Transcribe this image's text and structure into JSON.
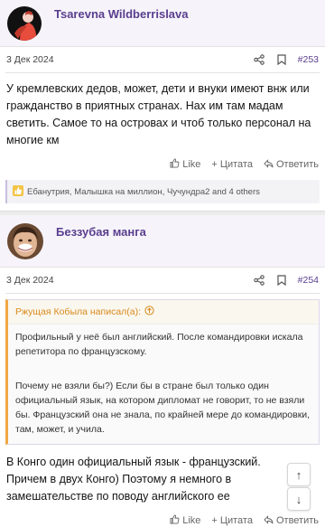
{
  "posts": [
    {
      "author": "Tsarevna Wildberrislava",
      "date": "3 Дек 2024",
      "number": "#253",
      "text": "У кремлевских дедов, может, дети и внуки имеют внж или гражданство в приятных странах. Нах им там мадам светить. Самое то на островах и чтоб только персонал на многие км",
      "actions": {
        "like": "Like",
        "quote": "Цитата",
        "reply": "Ответить"
      },
      "reactions": "Ебанутрия, Малышка на миллион, Чучундра2 and 4 others"
    },
    {
      "author": "Беззубая манга",
      "date": "3 Дек 2024",
      "number": "#254",
      "quote": {
        "header": "Ржущая Кобыла написал(а):",
        "paragraphs": [
          "Профильный у неё был английский. После командировки искала репетитора по французскому.",
          "Почему не взяли бы?) Если бы в стране был только один официальный язык, на котором дипломат не говорит, то не взяли бы. Французский она не знала, по крайней мере до командировки, там, может, и учила."
        ]
      },
      "text": "В Конго один официальный язык - французский. Причем в двух Конго) Поэтому я немного в замешательстве по поводу английского ее",
      "actions": {
        "like": "Like",
        "quote": "Цитата",
        "reply": "Ответить"
      }
    }
  ],
  "colors": {
    "accent": "#5a3e8e",
    "quote_accent": "#f0a845"
  }
}
